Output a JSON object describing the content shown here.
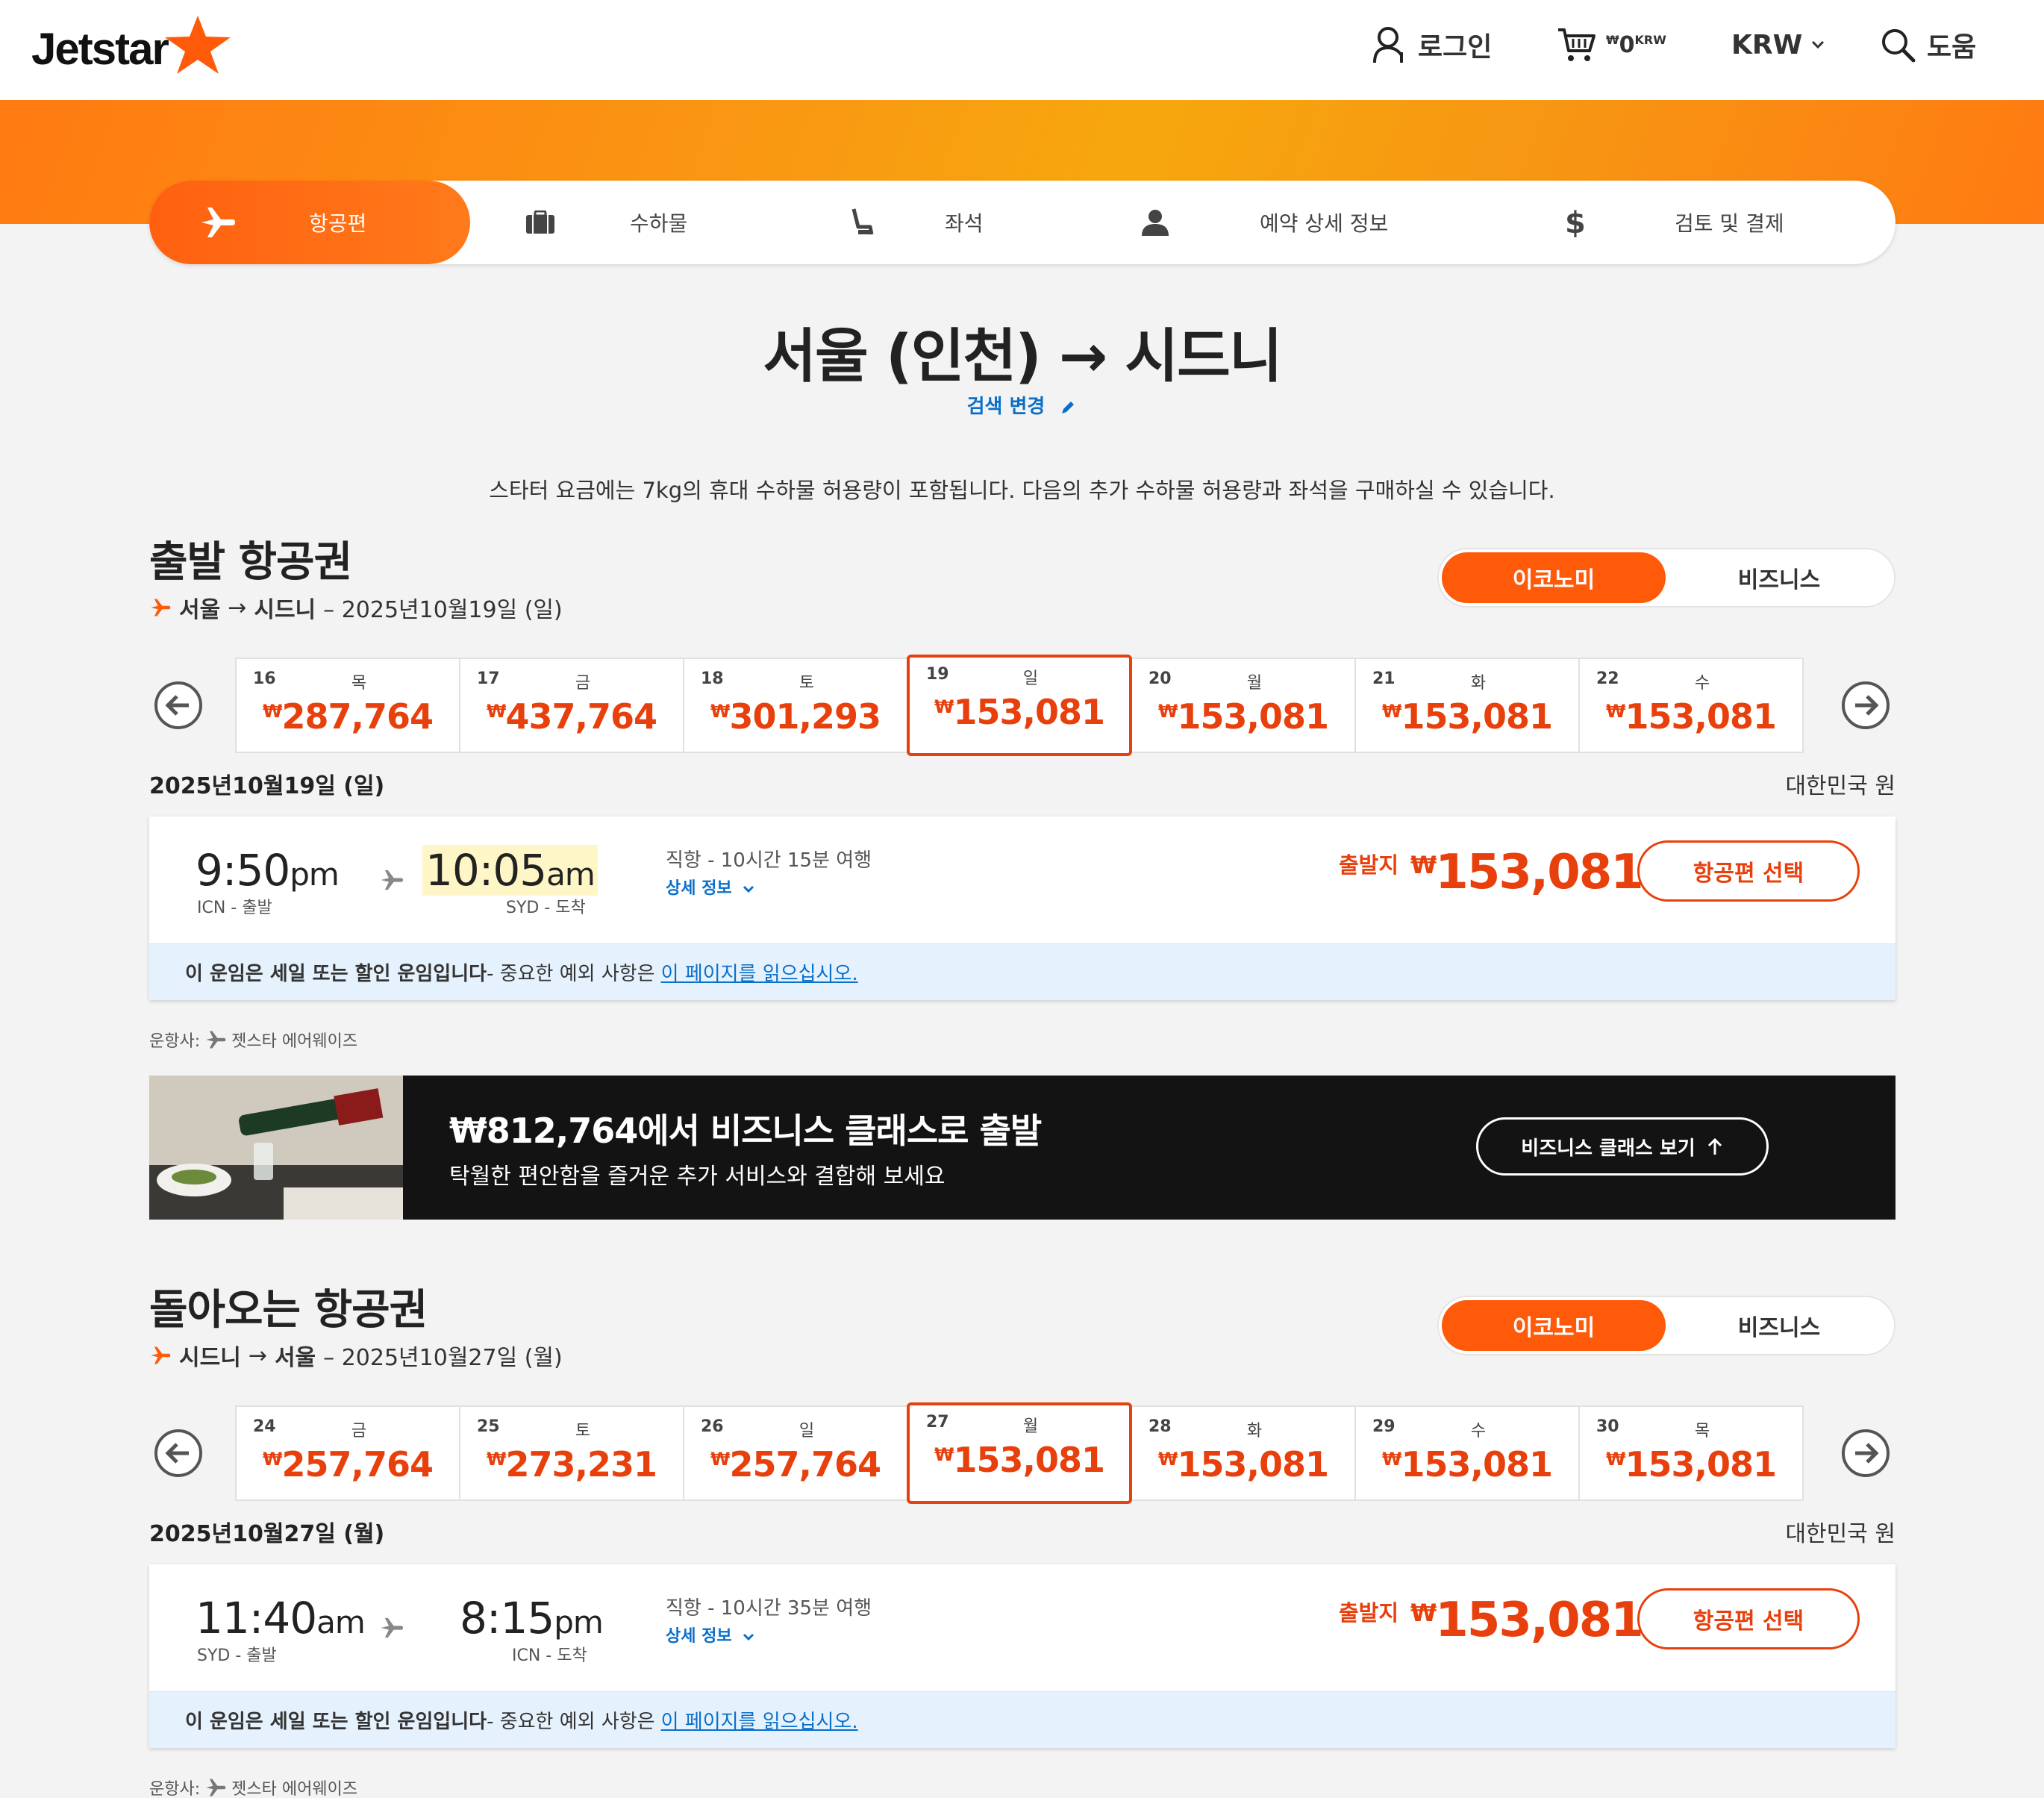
{
  "header": {
    "logo_text": "Jetstar",
    "login_label": "로그인",
    "cart_symbol": "₩",
    "cart_amount": "0",
    "cart_currency": "KRW",
    "currency_label": "KRW",
    "help_label": "도움",
    "brand_color": "#ff5a0a"
  },
  "stepper": {
    "steps": [
      {
        "label": "항공편",
        "icon": "plane-icon",
        "active": true
      },
      {
        "label": "수하물",
        "icon": "suitcase-icon",
        "active": false
      },
      {
        "label": "좌석",
        "icon": "seat-icon",
        "active": false
      },
      {
        "label": "예약 상세 정보",
        "icon": "person-icon",
        "active": false
      },
      {
        "label": "검토 및 결제",
        "icon": "dollar-icon",
        "active": false
      }
    ]
  },
  "page": {
    "title": "서울 (인천) → 시드니",
    "change_search": "검색 변경",
    "notice": "스타터 요금에는 7kg의 휴대 수하물 허용량이 포함됩니다. 다음의 추가 수하물 허용량과 좌석을 구매하실 수 있습니다."
  },
  "outbound": {
    "title": "출발 항공권",
    "route_from": "서울",
    "route_to": "시드니",
    "route_date": "– 2025년10월19일 (일)",
    "class_options": [
      "이코노미",
      "비즈니스"
    ],
    "dates": [
      {
        "day": "16",
        "weekday": "목",
        "price": "287,764",
        "selected": false
      },
      {
        "day": "17",
        "weekday": "금",
        "price": "437,764",
        "selected": false
      },
      {
        "day": "18",
        "weekday": "토",
        "price": "301,293",
        "selected": false
      },
      {
        "day": "19",
        "weekday": "일",
        "price": "153,081",
        "selected": true
      },
      {
        "day": "20",
        "weekday": "월",
        "price": "153,081",
        "selected": false
      },
      {
        "day": "21",
        "weekday": "화",
        "price": "153,081",
        "selected": false
      },
      {
        "day": "22",
        "weekday": "수",
        "price": "153,081",
        "selected": false
      }
    ],
    "date_line": "2025년10월19일 (일)",
    "currency_name": "대한민국 원",
    "flight": {
      "depart_time": "9:50",
      "depart_ampm": "pm",
      "depart_label": "ICN - 출발",
      "arrive_time": "10:05",
      "arrive_ampm": "am",
      "arrive_label": "SYD - 도착",
      "duration": "직항 - 10시간 15분 여행",
      "details_label": "상세 정보",
      "from_label": "출발지",
      "price_symbol": "₩",
      "price": "153,081",
      "select_label": "항공편 선택",
      "fare_note_bold": "이 운임은 세일 또는 할인 운임입니다",
      "fare_note_text": " - 중요한 예외 사항은",
      "fare_note_link": "이 페이지를 읽으십시오."
    },
    "operated_by_label": "운항사:",
    "operated_by": "젯스타 에어웨이즈"
  },
  "banner": {
    "title": "₩812,764에서 비즈니스 클래스로 출발",
    "subtitle": "탁월한 편안함을 즐거운 추가 서비스와 결합해 보세요",
    "button_label": "비즈니스 클래스 보기"
  },
  "return": {
    "title": "돌아오는 항공권",
    "route_from": "시드니",
    "route_to": "서울",
    "route_date": "– 2025년10월27일 (월)",
    "class_options": [
      "이코노미",
      "비즈니스"
    ],
    "dates": [
      {
        "day": "24",
        "weekday": "금",
        "price": "257,764",
        "selected": false
      },
      {
        "day": "25",
        "weekday": "토",
        "price": "273,231",
        "selected": false
      },
      {
        "day": "26",
        "weekday": "일",
        "price": "257,764",
        "selected": false
      },
      {
        "day": "27",
        "weekday": "월",
        "price": "153,081",
        "selected": true
      },
      {
        "day": "28",
        "weekday": "화",
        "price": "153,081",
        "selected": false
      },
      {
        "day": "29",
        "weekday": "수",
        "price": "153,081",
        "selected": false
      },
      {
        "day": "30",
        "weekday": "목",
        "price": "153,081",
        "selected": false
      }
    ],
    "date_line": "2025년10월27일 (월)",
    "currency_name": "대한민국 원",
    "flight": {
      "depart_time": "11:40",
      "depart_ampm": "am",
      "depart_label": "SYD - 출발",
      "arrive_time": "8:15",
      "arrive_ampm": "pm",
      "arrive_label": "ICN - 도착",
      "duration": "직항 - 10시간 35분 여행",
      "details_label": "상세 정보",
      "from_label": "출발지",
      "price_symbol": "₩",
      "price": "153,081",
      "select_label": "항공편 선택",
      "fare_note_bold": "이 운임은 세일 또는 할인 운임입니다",
      "fare_note_text": " - 중요한 예외 사항은",
      "fare_note_link": "이 페이지를 읽으십시오."
    },
    "operated_by_label": "운항사:",
    "operated_by": "젯스타 에어웨이즈"
  }
}
